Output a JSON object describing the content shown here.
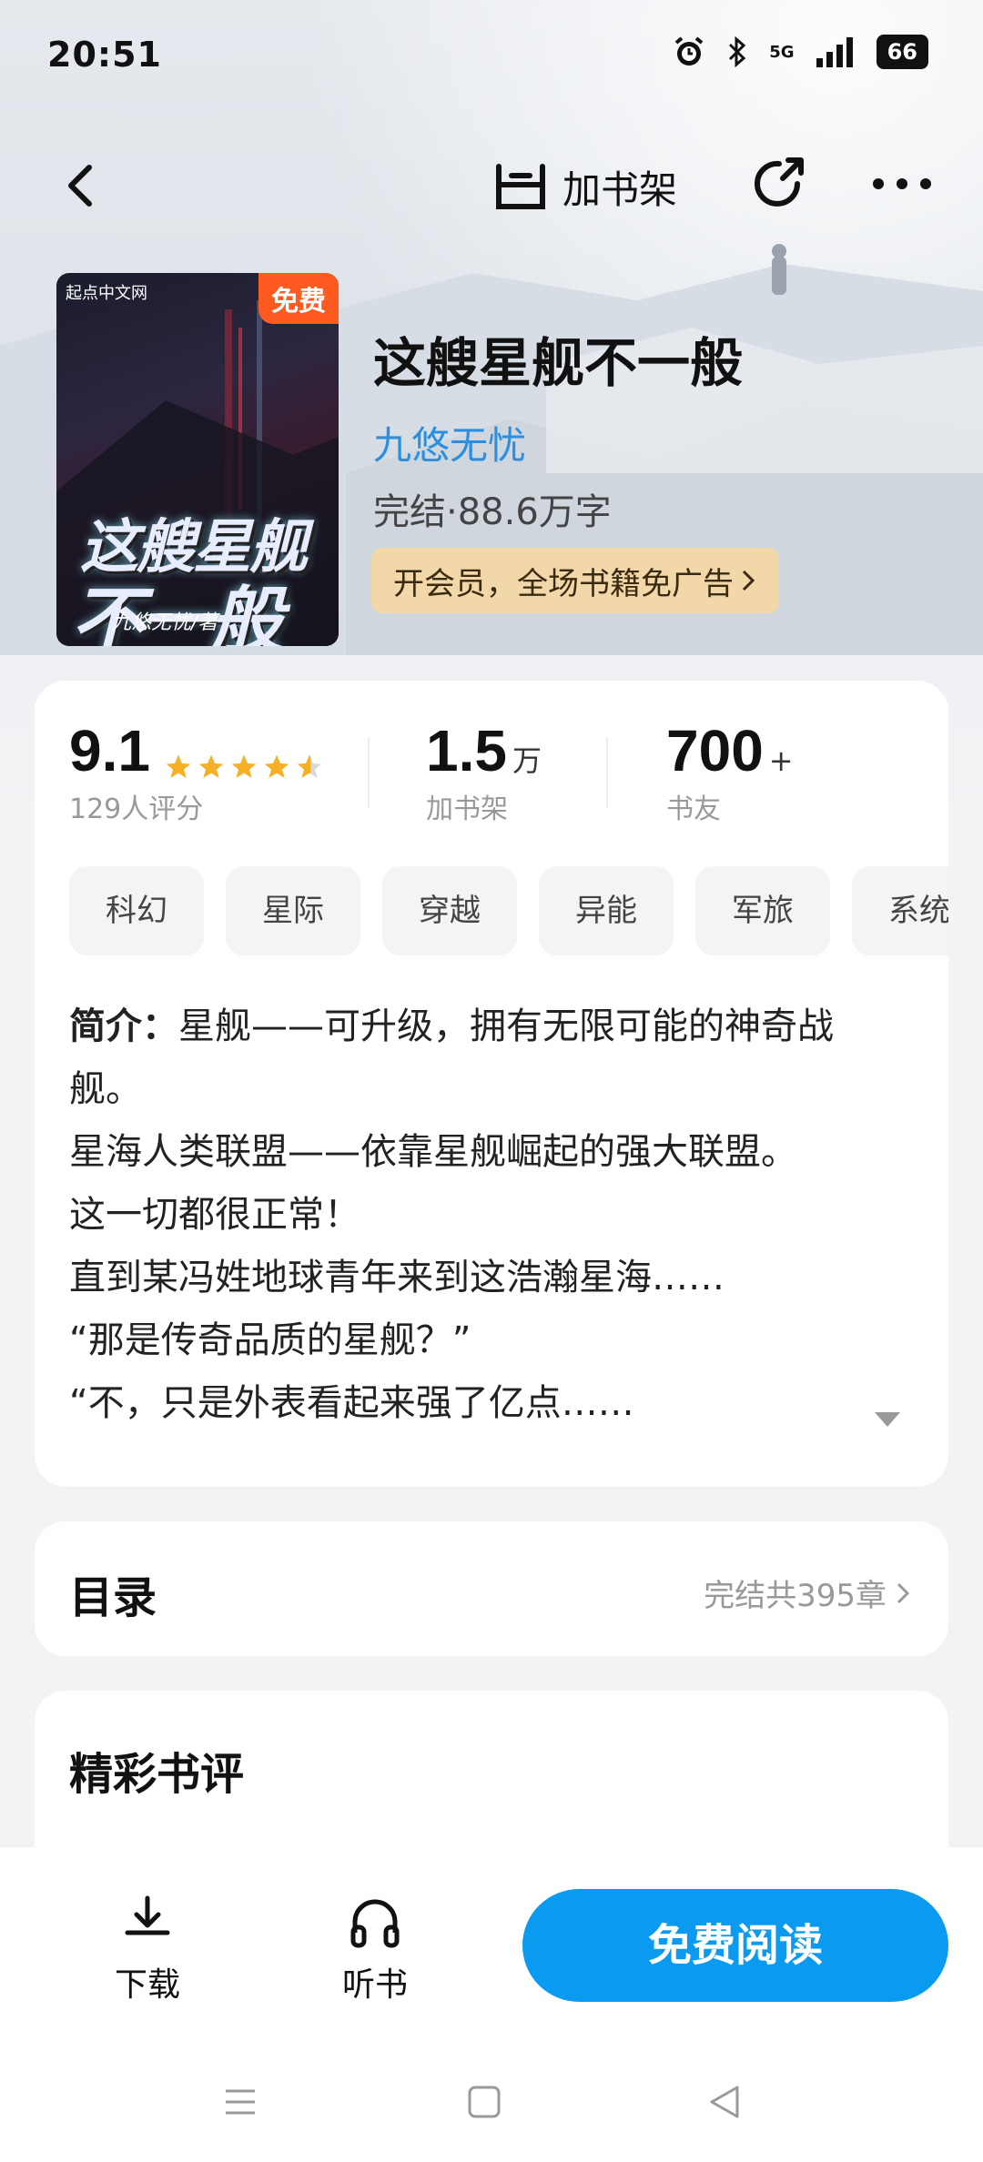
{
  "status_bar": {
    "time": "20:51",
    "network": "5G",
    "battery": "66"
  },
  "nav": {
    "add_shelf_label": "加书架"
  },
  "cover": {
    "badge": "免费",
    "brand": "起点中文网",
    "title_line1": "这艘星舰",
    "title_line2": "不一般",
    "author_sign": "九悠无忧/著"
  },
  "book": {
    "title": "这艘星舰不一般",
    "author": "九悠无忧",
    "meta": "完结·88.6万字",
    "vip_banner": "开会员，全场书籍免广告"
  },
  "stats": {
    "rating": "9.1",
    "rating_count": "129人评分",
    "shelf_count": "1.5",
    "shelf_unit": "万",
    "shelf_label": "加书架",
    "friends_count": "700",
    "friends_suffix": "+",
    "friends_label": "书友"
  },
  "tags": [
    "科幻",
    "星际",
    "穿越",
    "异能",
    "军旅",
    "系统"
  ],
  "intro": {
    "label": "简介：",
    "first": "星舰——可升级，拥有无限可能的神奇战",
    "lines": [
      "舰。",
      "星海人类联盟——依靠星舰崛起的强大联盟。",
      "这一切都很正常！",
      "直到某冯姓地球青年来到这浩瀚星海……",
      "“那是传奇品质的星舰？”",
      "“不，只是外表看起来强了亿点……"
    ]
  },
  "toc": {
    "title": "目录",
    "info": "完结共395章"
  },
  "reviews": {
    "title": "精彩书评"
  },
  "bottom": {
    "download": "下载",
    "listen": "听书",
    "read": "免费阅读"
  },
  "colors": {
    "accent": "#0a9bf0",
    "author_link": "#2a8fe0",
    "free_badge": "#ff5a1f",
    "star": "#f6b026",
    "vip_bg": "#f2d7a8"
  }
}
